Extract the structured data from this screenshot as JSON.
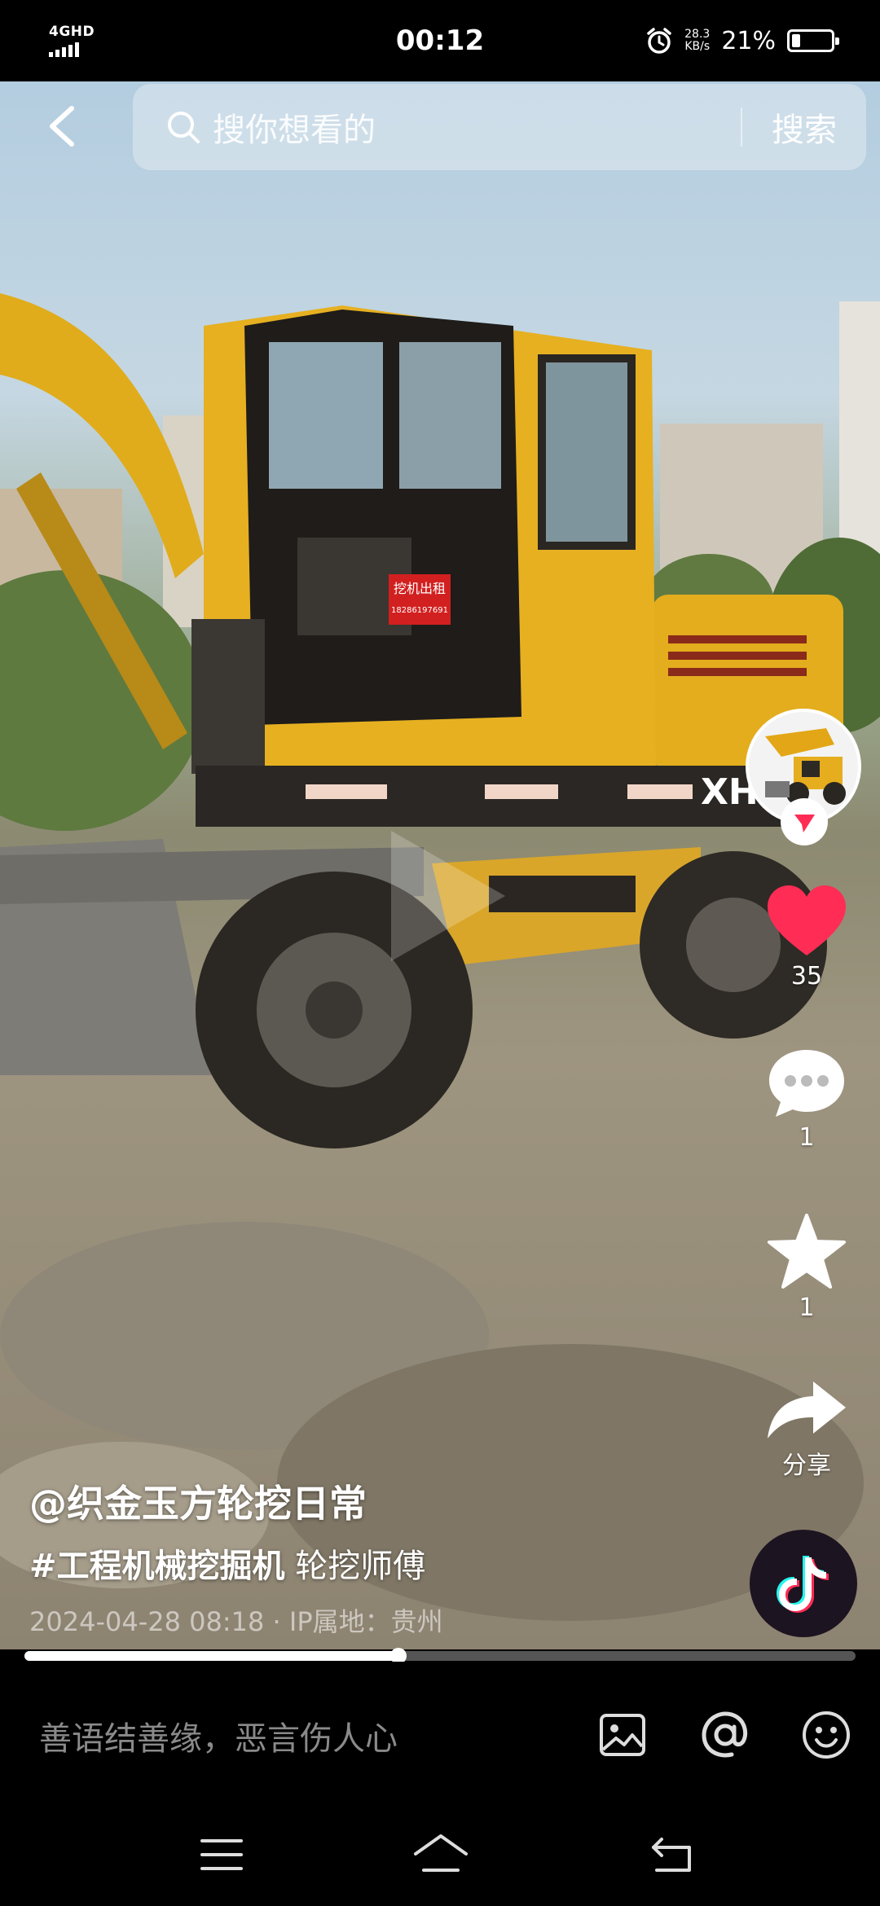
{
  "status_bar": {
    "network": "4GHD",
    "time": "00:12",
    "speed_value": "28.3",
    "speed_unit": "KB/s",
    "battery_percent": "21%",
    "battery_level": 0.21,
    "icons": [
      "signal-icon",
      "alarm-icon",
      "battery-icon"
    ]
  },
  "search": {
    "placeholder": "搜你想看的",
    "button_label": "搜索"
  },
  "video": {
    "sign_line1": "挖机出租",
    "sign_line2": "18286197691",
    "model_text": "XH9"
  },
  "actions": {
    "likes": "35",
    "comments": "1",
    "favorites": "1",
    "share_label": "分享",
    "like_color": "#ff2d55"
  },
  "caption": {
    "author": "@织金玉方轮挖日常",
    "hashtag": "#工程机械挖掘机",
    "text": "轮挖师傅",
    "meta": "2024-04-28 08:18 · IP属地：贵州"
  },
  "progress": {
    "fraction": 0.45
  },
  "comment_bar": {
    "placeholder": "善语结善缘，恶言伤人心",
    "icons": [
      "image-icon",
      "at-icon",
      "emoji-icon"
    ]
  },
  "nav_bar": {
    "icons": [
      "menu-icon",
      "home-icon",
      "back-nav-icon"
    ]
  }
}
